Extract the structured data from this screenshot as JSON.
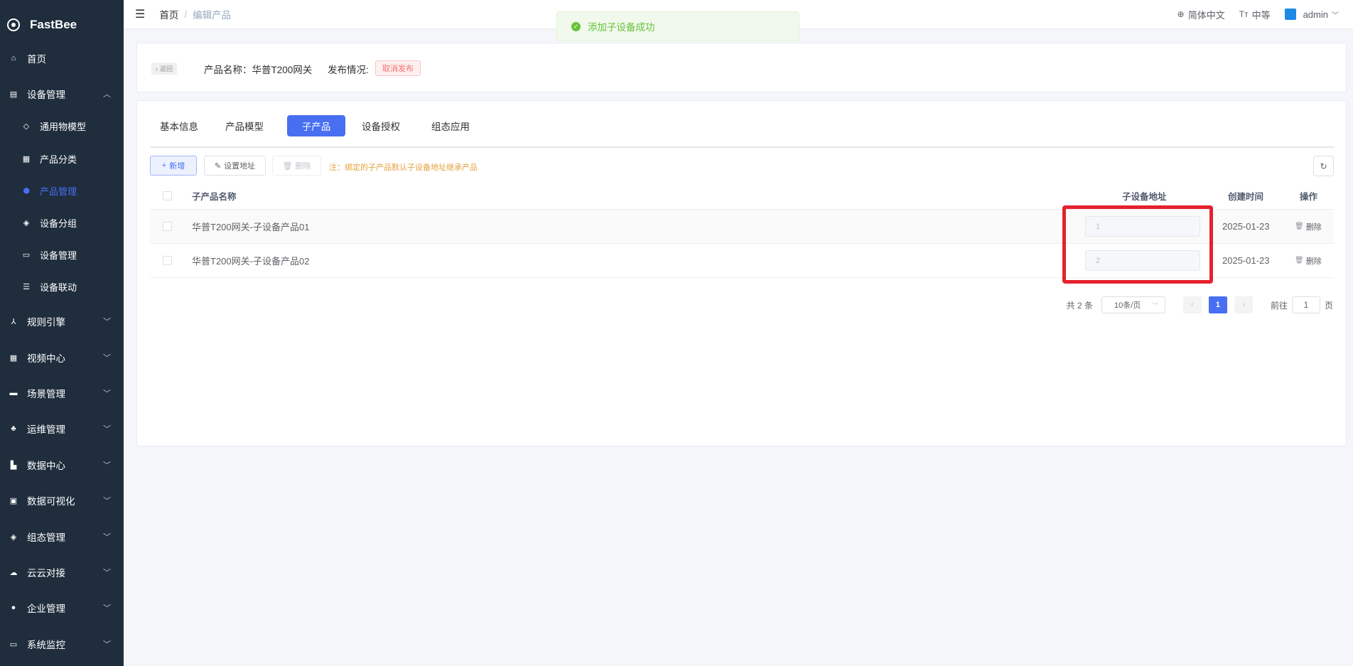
{
  "app": {
    "name": "FastBee"
  },
  "sidebar": {
    "items": [
      {
        "label": "首页",
        "icon": "home-icon"
      },
      {
        "label": "设备管理",
        "icon": "device-icon",
        "expanded": true
      },
      {
        "label": "通用物模型",
        "icon": "model-icon"
      },
      {
        "label": "产品分类",
        "icon": "category-icon"
      },
      {
        "label": "产品管理",
        "icon": "cube-icon",
        "active": true
      },
      {
        "label": "设备分组",
        "icon": "layers-icon"
      },
      {
        "label": "设备管理",
        "icon": "drive-icon"
      },
      {
        "label": "设备联动",
        "icon": "list-icon"
      },
      {
        "label": "规则引擎",
        "icon": "share-icon"
      },
      {
        "label": "视频中心",
        "icon": "grid-icon"
      },
      {
        "label": "场景管理",
        "icon": "card-icon"
      },
      {
        "label": "运维管理",
        "icon": "tree-icon"
      },
      {
        "label": "数据中心",
        "icon": "bar-chart-icon"
      },
      {
        "label": "数据可视化",
        "icon": "monitor-icon"
      },
      {
        "label": "组态管理",
        "icon": "stack-icon"
      },
      {
        "label": "云云对接",
        "icon": "cloud-icon"
      },
      {
        "label": "企业管理",
        "icon": "building-icon"
      },
      {
        "label": "系统监控",
        "icon": "screen-icon"
      }
    ]
  },
  "topbar": {
    "breadcrumb_home": "首页",
    "breadcrumb_sep": "/",
    "breadcrumb_current": "编辑产品",
    "language": "简体中文",
    "font_size": "中等",
    "user": "admin"
  },
  "toast": {
    "message": "添加子设备成功"
  },
  "header": {
    "back_label": "返回",
    "product_name": "产品名称：华普T200网关",
    "publish_label": "发布情况:",
    "publish_tag": "取消发布"
  },
  "tabs": [
    "基本信息",
    "产品模型",
    "子产品",
    "设备授权",
    "组态应用"
  ],
  "active_tab": "子产品",
  "toolbar": {
    "add_label": "新增",
    "set_address_label": "设置地址",
    "delete_label": "删除",
    "note": "注：绑定的子产品默认子设备地址继承产品"
  },
  "table": {
    "columns": [
      "子产品名称",
      "子设备地址",
      "创建时间",
      "操作"
    ],
    "rows": [
      {
        "name": "华普T200网关-子设备产品01",
        "address": "1",
        "created": "2025-01-23",
        "action": "删除"
      },
      {
        "name": "华普T200网关-子设备产品02",
        "address": "2",
        "created": "2025-01-23",
        "action": "删除"
      }
    ]
  },
  "pagination": {
    "total": "共 2 条",
    "page_size": "10条/页",
    "current_page": "1",
    "goto_prefix": "前往",
    "goto_value": "1",
    "goto_suffix": "页"
  },
  "colors": {
    "sidebar_bg": "#1f2d3d",
    "primary": "#486ff2",
    "highlight": "#e4222d",
    "success": "#67c23a",
    "warning": "#e6a23c"
  }
}
